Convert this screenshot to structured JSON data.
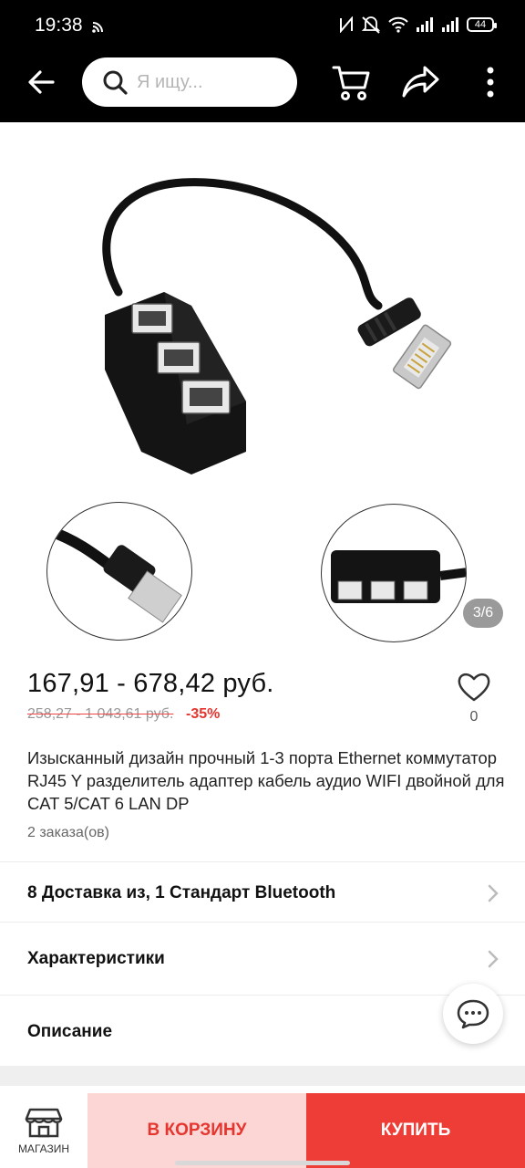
{
  "status_bar": {
    "time": "19:38",
    "battery": "44"
  },
  "header": {
    "search_placeholder": "Я ищу..."
  },
  "gallery": {
    "counter": "3/6"
  },
  "product": {
    "price": "167,91 - 678,42 руб.",
    "old_price": "258,27 - 1 043,61 руб.",
    "discount": "-35%",
    "wishlist_count": "0",
    "title": "Изысканный дизайн прочный 1-3 порта Ethernet коммутатор RJ45 Y разделитель адаптер кабель аудио WIFI двойной для CAT 5/CAT 6 LAN DP",
    "orders": "2 заказа(ов)"
  },
  "sections": {
    "delivery": "8 Доставка из, 1 Стандарт Bluetooth",
    "specs": "Характеристики",
    "description": "Описание"
  },
  "bottom_bar": {
    "shop_label": "МАГАЗИН",
    "cart_label": "В КОРЗИНУ",
    "buy_label": "КУПИТЬ"
  },
  "colors": {
    "accent": "#ee3d37",
    "cart_bg": "#fbd6d4",
    "discount": "#e5352e"
  }
}
